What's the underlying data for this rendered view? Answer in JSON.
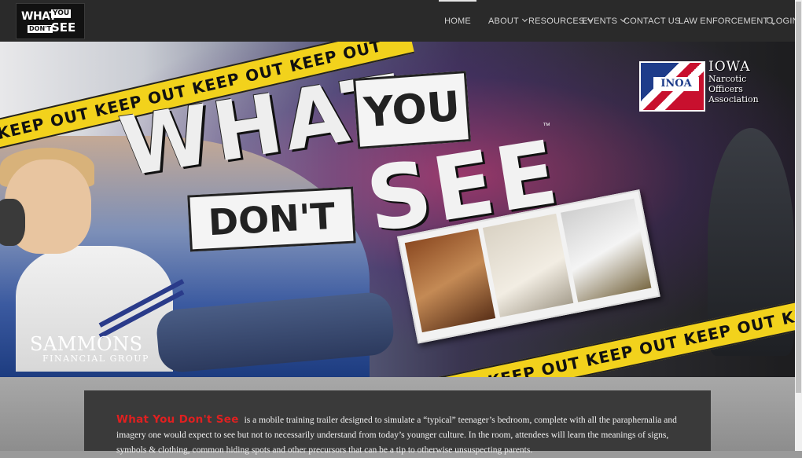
{
  "header": {
    "logo": {
      "line1": "WHAT",
      "line2": "YOU",
      "line3": "DON'T",
      "line4": "SEE"
    },
    "nav": [
      {
        "label": "HOME",
        "dropdown": false,
        "active": true
      },
      {
        "label": "ABOUT",
        "dropdown": true
      },
      {
        "label": "RESOURCES",
        "dropdown": true
      },
      {
        "label": "EVENTS",
        "dropdown": true
      },
      {
        "label": "CONTACT US",
        "dropdown": false
      },
      {
        "label": "LAW ENFORCEMENT LOGIN",
        "dropdown": false
      }
    ],
    "search_icon": "search-icon"
  },
  "hero": {
    "tape_text": "KEEP OUT   KEEP OUT   KEEP OUT   KEEP OUT",
    "tape_text_2": "KEEP OUT   KEEP OUT   KEEP OUT   KEEP OUT   KEEP OUT",
    "title_what": "WHAT",
    "title_you": "YOU",
    "title_dont": "DON'T",
    "title_see": "SEE",
    "tm": "™",
    "iowa": {
      "inoa": "INOA",
      "t1": "IOWA",
      "t2": "Narcotic",
      "t3": "Officers",
      "t4": "Association"
    },
    "sammons": {
      "name": "SAMMONS",
      "sub": "FINANCIAL GROUP"
    }
  },
  "intro": {
    "brand": "What You Don't See",
    "text": "is a mobile training trailer designed to simulate a “typical” teenager’s bedroom, complete with all the paraphernalia and imagery one would expect to see but not to necessarily understand from today’s younger culture. In the room, attendees will learn the meanings of signs, symbols & clothing, common hiding spots and other precursors that can be a tip to otherwise unsuspecting parents."
  },
  "colors": {
    "header_bg": "#2a2a2a",
    "tape": "#f2d21c",
    "brand_red": "#e02020"
  }
}
